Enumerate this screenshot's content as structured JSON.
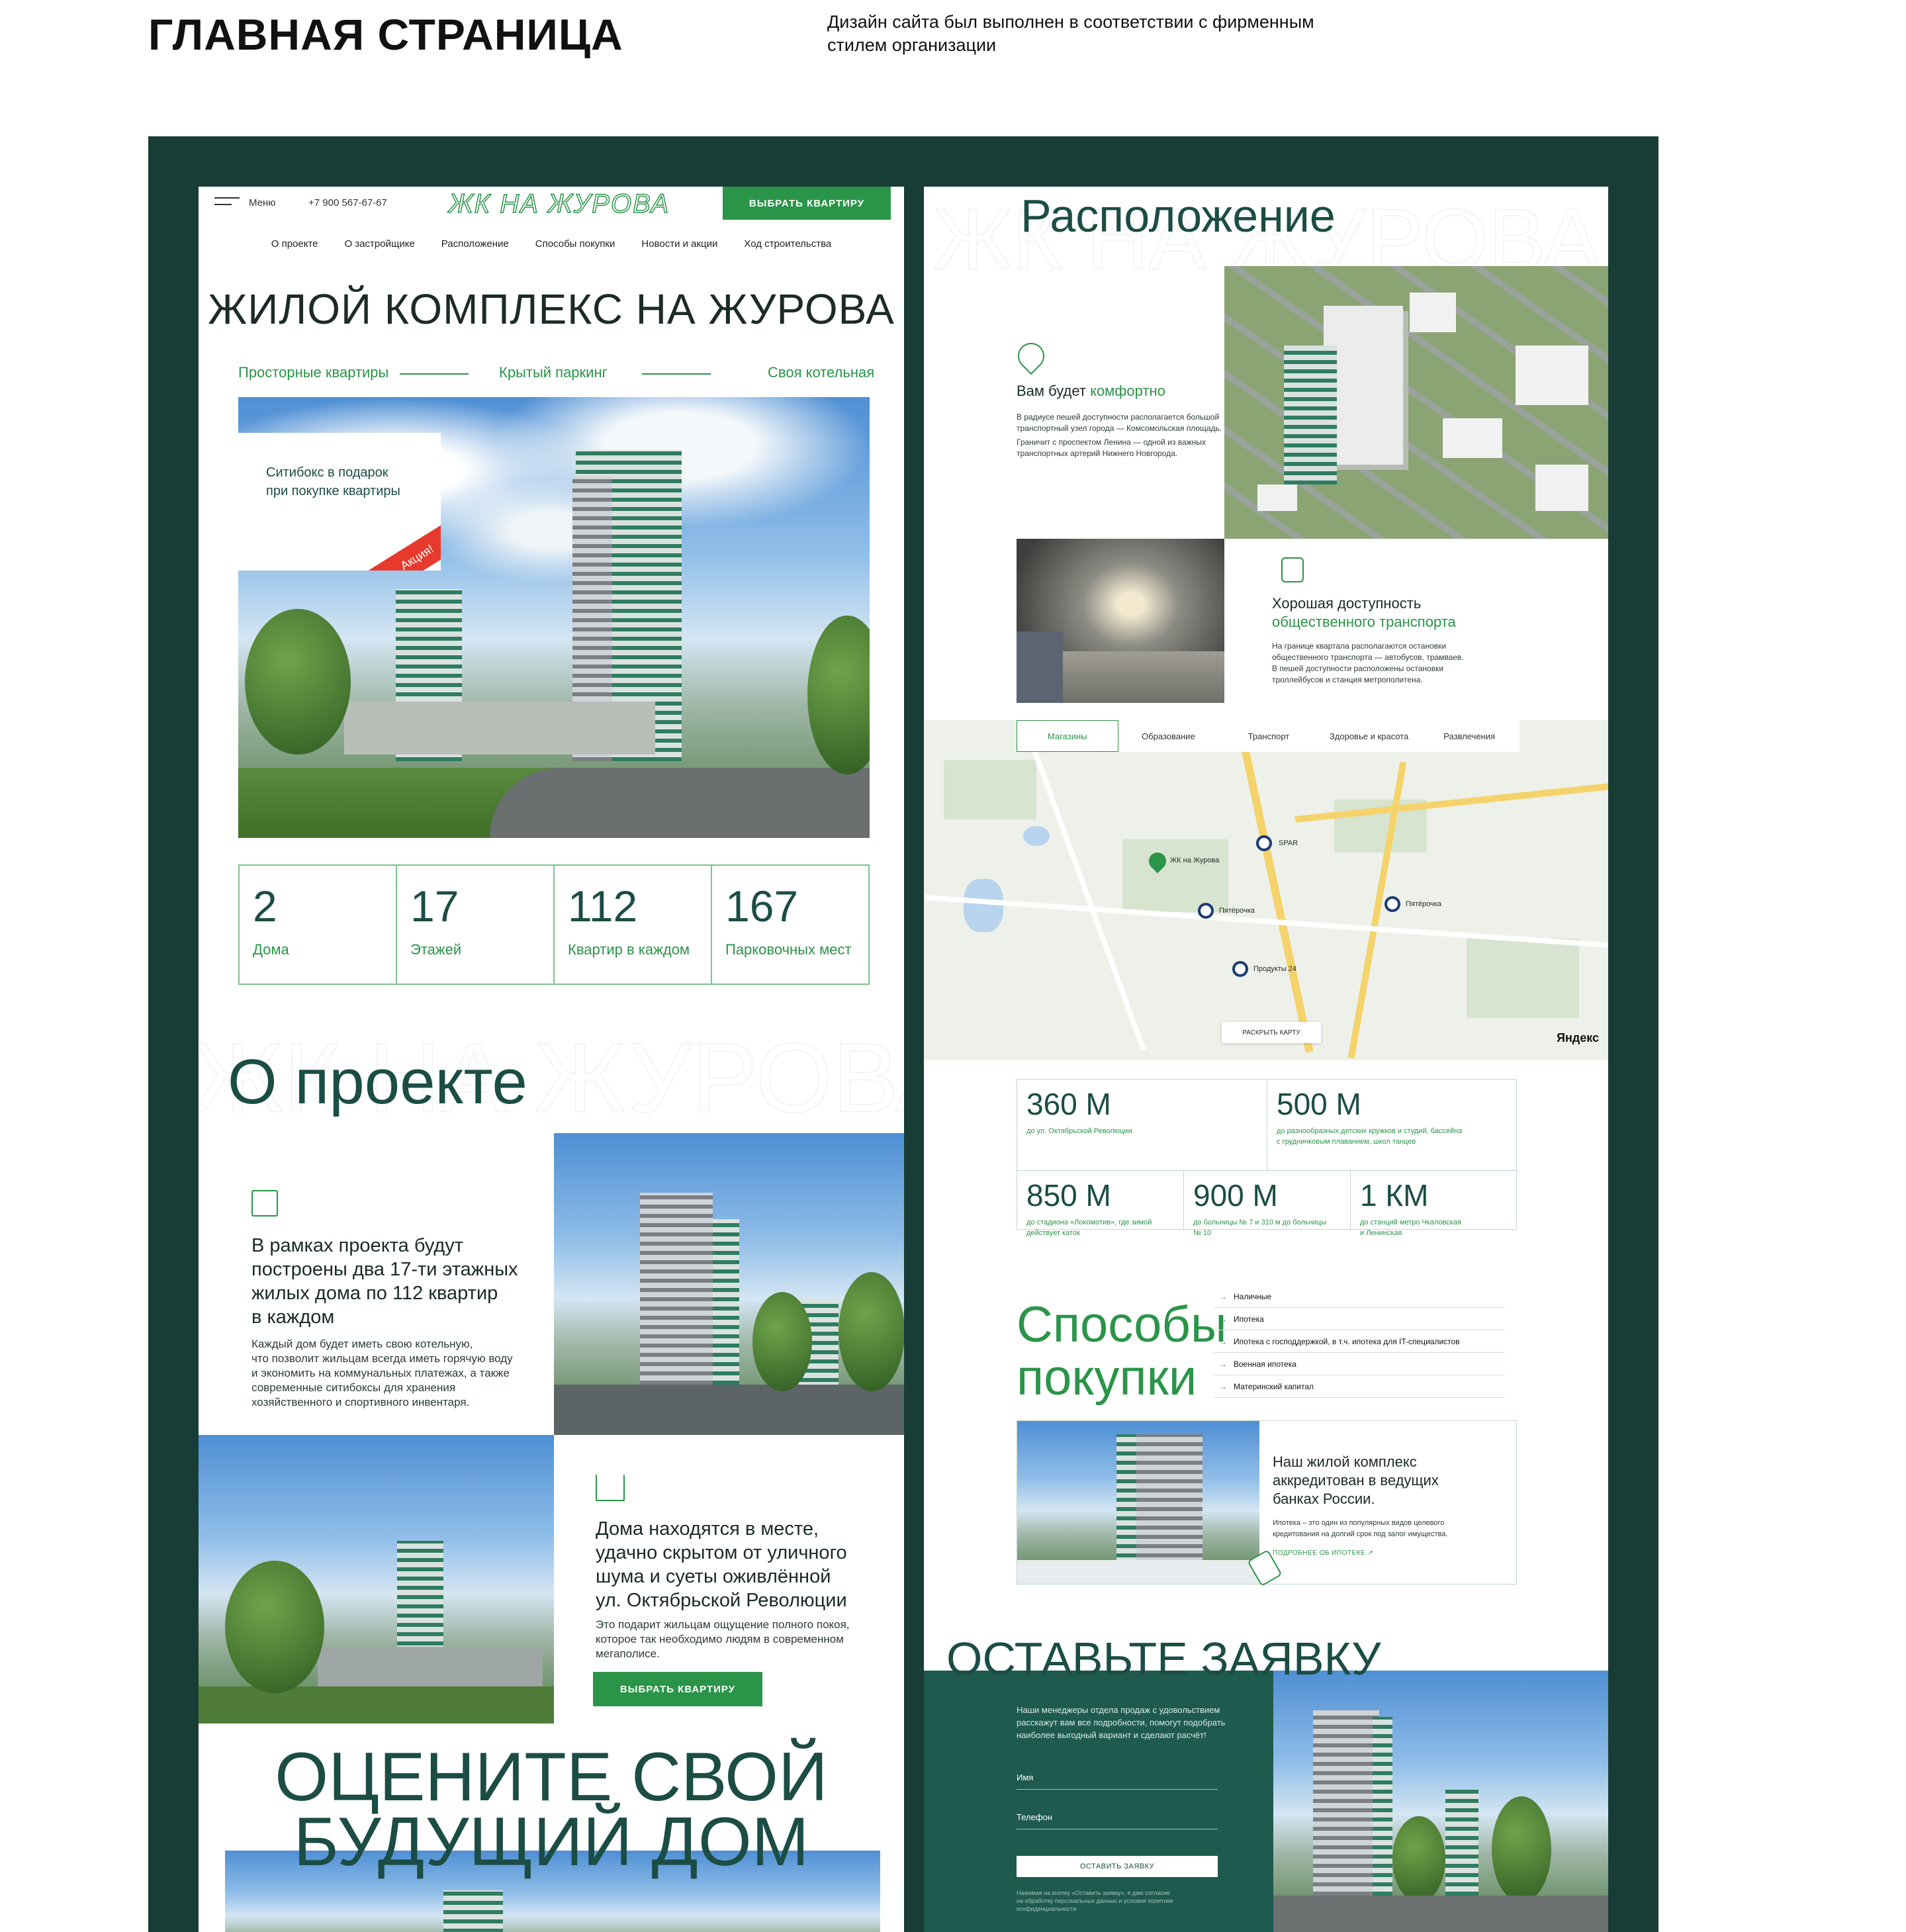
{
  "presentation": {
    "title": "ГЛАВНАЯ СТРАНИЦА",
    "description_line1": "Дизайн сайта был выполнен в соответствии с фирменным",
    "description_line2": "стилем организации"
  },
  "header": {
    "menu_label": "Меню",
    "phone": "+7 900 567-67-67",
    "logo": "ЖК НА ЖУРОВА",
    "cta": "ВЫБРАТЬ КВАРТИРУ"
  },
  "nav": [
    "О проекте",
    "О застройщике",
    "Расположение",
    "Способы покупки",
    "Новости и акции",
    "Ход строительства"
  ],
  "hero": {
    "title": "ЖИЛОЙ КОМПЛЕКС НА ЖУРОВА",
    "features": [
      "Просторные квартиры",
      "Крытый паркинг",
      "Своя котельная"
    ],
    "promo_line1": "Ситибокс в подарок",
    "promo_line2": "при покупке квартиры",
    "promo_badge": "Акция!"
  },
  "stats": [
    {
      "value": "2",
      "label": "Дома"
    },
    {
      "value": "17",
      "label": "Этажей"
    },
    {
      "value": "112",
      "label": "Квартир в каждом"
    },
    {
      "value": "167",
      "label": "Парковочных мест"
    }
  ],
  "about": {
    "bg_word": "ЖК НА ЖУРОВА",
    "title": "О проекте",
    "block1_heading_1": "В рамках проекта будут",
    "block1_heading_2": "построены два 17-ти этажных",
    "block1_heading_3": "жилых дома по 112 квартир",
    "block1_heading_4": "в каждом",
    "block1_text_1": "Каждый дом будет иметь свою котельную,",
    "block1_text_2": "что позволит жильцам всегда иметь горячую воду",
    "block1_text_3": "и экономить на коммунальных платежах, а также",
    "block1_text_4": "современные ситибоксы для хранения",
    "block1_text_5": "хозяйственного и спортивного инвентаря.",
    "block2_heading_1": "Дома находятся в месте,",
    "block2_heading_2": "удачно скрытом от уличного",
    "block2_heading_3": "шума и суеты оживлённой",
    "block2_heading_4": "ул. Октябрьской Революции",
    "block2_text_1": "Это подарит жильцам ощущение полного покоя,",
    "block2_text_2": "которое так необходимо людям в современном",
    "block2_text_3": "мегаполисе.",
    "block2_cta": "ВЫБРАТЬ КВАРТИРУ"
  },
  "evaluate": {
    "line1": "ОЦЕНИТЕ СВОЙ",
    "line2": "БУДУЩИЙ ДОМ"
  },
  "location": {
    "bg_word": "ЖК НА ЖУРОВА",
    "title": "Расположение",
    "comfort_prefix": "Вам будет ",
    "comfort_accent": "комфортно",
    "comfort_text_1": "В радиусе пешей доступности располагается большой",
    "comfort_text_2": "транспортный узел города — Комсомольская площадь.",
    "comfort_text_3": "Граничит с проспектом Ленина — одной из важных",
    "comfort_text_4": "транспортных артерий Нижнего Новгорода.",
    "transport_line1": "Хорошая доступность",
    "transport_line2": "общественного транспорта",
    "transport_text_1": "На границе квартала располагаются остановки",
    "transport_text_2": "общественного транспорта — автобусов, трамваев.",
    "transport_text_3": "В пешей доступности расположены остановки",
    "transport_text_4": "троллейбусов и станция метрополитена."
  },
  "map": {
    "tabs": [
      "Магазины",
      "Образование",
      "Транспорт",
      "Здоровье и красота",
      "Развлечения"
    ],
    "active_tab": "Магазины",
    "pins": [
      "ЖК на Журова",
      "SPAR",
      "Пятёрочка",
      "Пятёрочка",
      "Продукты 24"
    ],
    "expand": "РАСКРЫТЬ КАРТУ",
    "provider": "Яндекс"
  },
  "distances": [
    {
      "value": "360 М",
      "text1": "до ул. Октябрьской Революции",
      "text2": ""
    },
    {
      "value": "500 М",
      "text1": "до разнообразных детских кружков и студий, бассейна",
      "text2": "с грудничковым плаванием, школ танцев"
    },
    {
      "value": "850 М",
      "text1": "до стадиона «Локомотив», где зимой",
      "text2": "действует каток"
    },
    {
      "value": "900 М",
      "text1": "до больницы № 7 и 310 м до больницы",
      "text2": "№ 10"
    },
    {
      "value": "1 КМ",
      "text1": "до станций метро Чкаловская",
      "text2": "и Ленинская"
    }
  ],
  "purchase": {
    "title1": "Способы",
    "title2": "покупки",
    "items": [
      "Наличные",
      "Ипотека",
      "Ипотека с господдержкой, в т.ч. ипотека для IT-специалистов",
      "Военная ипотека",
      "Материнский капитал"
    ],
    "bank_line1": "Наш жилой комплекс",
    "bank_line2": "аккредитован в ведущих",
    "bank_line3": "банках России.",
    "bank_text_1": "Ипотека – это один из популярных видов целевого",
    "bank_text_2": "кредитования на долгий срок под залог имущества.",
    "bank_link": "ПОДРОБНЕЕ ОБ ИПОТЕКЕ"
  },
  "request": {
    "title": "ОСТАВЬТЕ ЗАЯВКУ",
    "text_1": "Наши менеджеры отдела продаж с удовольствием",
    "text_2": "расскажут вам все подробности, помогут подобрать",
    "text_3": "наиболее выгодный вариант и сделают расчёт!",
    "name_placeholder": "Имя",
    "phone_placeholder": "Телефон",
    "submit": "ОСТАВИТЬ ЗАЯВКУ",
    "consent_1": "Нажимая на кнопку «Оставить заявку», я даю согласие",
    "consent_2": "на обработку персональных данных и условия политики",
    "consent_3": "конфиденциальности"
  },
  "colors": {
    "board": "#183d36",
    "accent": "#2a9448",
    "dark": "#1b4d44",
    "promo": "#e8392d"
  }
}
